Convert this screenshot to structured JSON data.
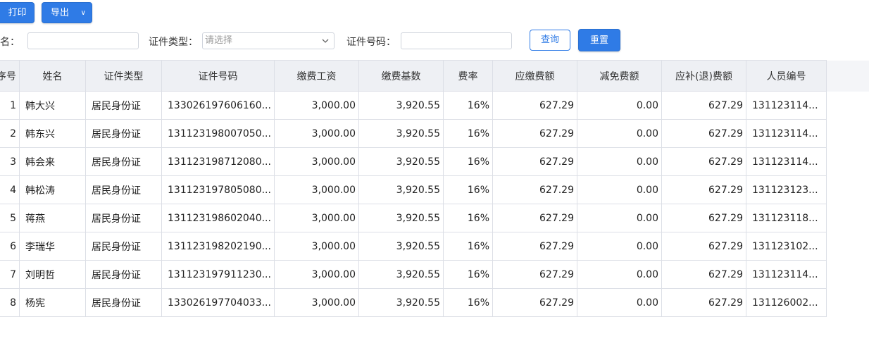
{
  "toolbar": {
    "print_label": "打印",
    "export_label": "导出",
    "export_chevron": "∨"
  },
  "filters": {
    "name_label": "姓名：",
    "name_value": "",
    "idtype_label": "证件类型：",
    "idtype_placeholder": "请选择",
    "idno_label": "证件号码：",
    "idno_value": "",
    "query_label": "查询",
    "reset_label": "重置"
  },
  "table": {
    "headers": [
      "序号",
      "姓名",
      "证件类型",
      "证件号码",
      "缴费工资",
      "缴费基数",
      "费率",
      "应缴费额",
      "减免费额",
      "应补(退)费额",
      "人员编号"
    ],
    "rows": [
      [
        "1",
        "韩大兴",
        "居民身份证",
        "133026197606160...",
        "3,000.00",
        "3,920.55",
        "16%",
        "627.29",
        "0.00",
        "627.29",
        "131123114..."
      ],
      [
        "2",
        "韩东兴",
        "居民身份证",
        "131123198007050...",
        "3,000.00",
        "3,920.55",
        "16%",
        "627.29",
        "0.00",
        "627.29",
        "131123114..."
      ],
      [
        "3",
        "韩会来",
        "居民身份证",
        "131123198712080...",
        "3,000.00",
        "3,920.55",
        "16%",
        "627.29",
        "0.00",
        "627.29",
        "131123114..."
      ],
      [
        "4",
        "韩松涛",
        "居民身份证",
        "131123197805080...",
        "3,000.00",
        "3,920.55",
        "16%",
        "627.29",
        "0.00",
        "627.29",
        "131123123..."
      ],
      [
        "5",
        "蒋燕",
        "居民身份证",
        "131123198602040...",
        "3,000.00",
        "3,920.55",
        "16%",
        "627.29",
        "0.00",
        "627.29",
        "131123118..."
      ],
      [
        "6",
        "李瑞华",
        "居民身份证",
        "131123198202190...",
        "3,000.00",
        "3,920.55",
        "16%",
        "627.29",
        "0.00",
        "627.29",
        "131123102..."
      ],
      [
        "7",
        "刘明哲",
        "居民身份证",
        "131123197911230...",
        "3,000.00",
        "3,920.55",
        "16%",
        "627.29",
        "0.00",
        "627.29",
        "131123114..."
      ],
      [
        "8",
        "杨宪",
        "居民身份证",
        "133026197704033...",
        "3,000.00",
        "3,920.55",
        "16%",
        "627.29",
        "0.00",
        "627.29",
        "131126002..."
      ]
    ]
  },
  "colors": {
    "primary": "#2f7be6",
    "header_bg": "#eef0f4",
    "border": "#dcdfe6"
  }
}
